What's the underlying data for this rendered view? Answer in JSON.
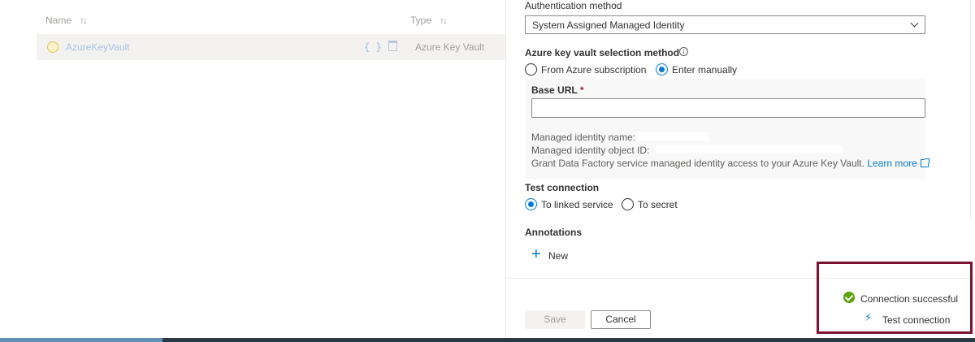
{
  "list": {
    "columns": [
      {
        "label": "Name",
        "sort_icon": "sort-icon"
      },
      {
        "label": "Type",
        "sort_icon": "sort-icon"
      }
    ],
    "rows": [
      {
        "name": "AzureKeyVault",
        "type": "Azure Key Vault",
        "icon": "key-vault-icon"
      }
    ]
  },
  "panel": {
    "auth_method": {
      "label": "Authentication method",
      "value": "System Assigned Managed Identity"
    },
    "kv_selection": {
      "label": "Azure key vault selection method",
      "options": [
        "From Azure subscription",
        "Enter manually"
      ],
      "selected": "Enter manually"
    },
    "base_url": {
      "label": "Base URL",
      "required_mark": "*",
      "value": ""
    },
    "managed_identity": {
      "name_label": "Managed identity name:",
      "object_id_label": "Managed identity object ID:",
      "grant_text": "Grant Data Factory service managed identity access to your Azure Key Vault.",
      "learn_more": "Learn more"
    },
    "test_connection": {
      "label": "Test connection",
      "options": [
        "To linked service",
        "To secret"
      ],
      "selected": "To linked service"
    },
    "annotations": {
      "label": "Annotations",
      "new_label": "New"
    },
    "footer": {
      "save_label": "Save",
      "cancel_label": "Cancel",
      "status_text": "Connection successful",
      "test_connection_label": "Test connection"
    }
  },
  "colors": {
    "accent": "#0078d4",
    "success": "#57a300",
    "highlight_border": "#7b1430"
  }
}
